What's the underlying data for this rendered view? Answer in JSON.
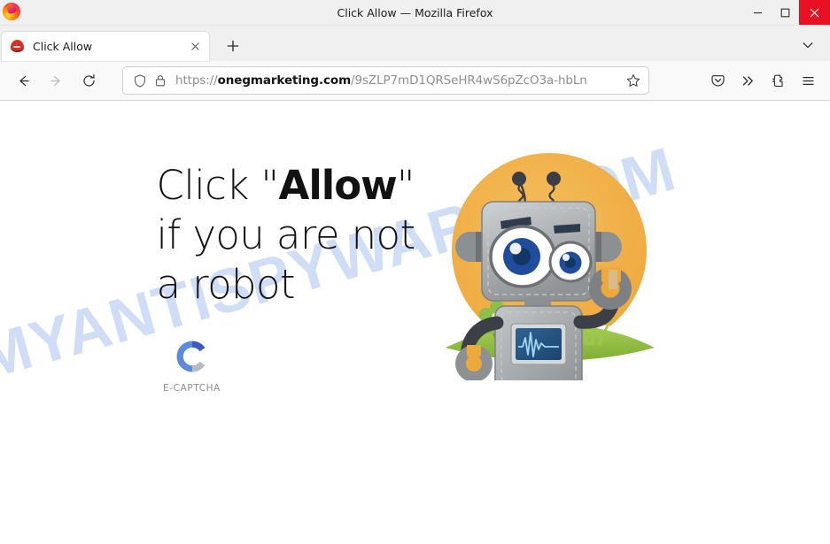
{
  "window": {
    "title": "Click Allow — Mozilla Firefox",
    "app_icon": "firefox-logo-icon",
    "controls": {
      "minimize": "minimize-icon",
      "maximize": "maximize-icon",
      "close": "close-icon"
    },
    "close_color": "#e81123"
  },
  "tabstrip": {
    "tabs": [
      {
        "title": "Click Allow",
        "favicon": "site-favicon",
        "close": "tab-close-icon"
      }
    ],
    "new_tab": "plus-icon",
    "list_all_tabs": "chevron-down-icon"
  },
  "navbar": {
    "back": "arrow-left-icon",
    "forward": "arrow-right-icon",
    "reload": "reload-icon",
    "tracking_protection": "shield-icon",
    "lock": "padlock-icon",
    "url_scheme": "https://",
    "url_host": "onegmarketing.com",
    "url_path": "/9sZLP7mD1QRSeHR4wS6pZcO3a-hbLn",
    "url_full": "https://onegmarketing.com/9sZLP7mD1QRSeHR4wS6pZcO3a-hbLn",
    "bookmark": "star-icon",
    "pocket": "pocket-icon",
    "overflow": "chevron-double-right-icon",
    "extensions": "extensions-icon",
    "app_menu": "hamburger-menu-icon"
  },
  "page": {
    "watermark": "MYANTISPYWARE.COM",
    "watermark_color": "#cddcf6",
    "headline_part1": "Click \"",
    "headline_bold": "Allow",
    "headline_part2": "\" if you are not a robot",
    "headline_full": "Click \"Allow\" if you are not a robot",
    "captcha": {
      "logo_icon": "e-captcha-logo-icon",
      "label": "E-CAPTCHA",
      "color_dark_blue": "#3b5bbf",
      "color_light_blue": "#5b8ae0",
      "color_gray": "#b8bcc2"
    },
    "illustration": {
      "name": "robot-mascot-illustration",
      "background_circle_color": "#f0b14a",
      "robot_body_color": "#a8abad",
      "eye_color": "#1f4d9b",
      "grass_color": "#8cb83f",
      "flower_color": "#7fb241",
      "screen_color": "#2a5d8f"
    }
  }
}
